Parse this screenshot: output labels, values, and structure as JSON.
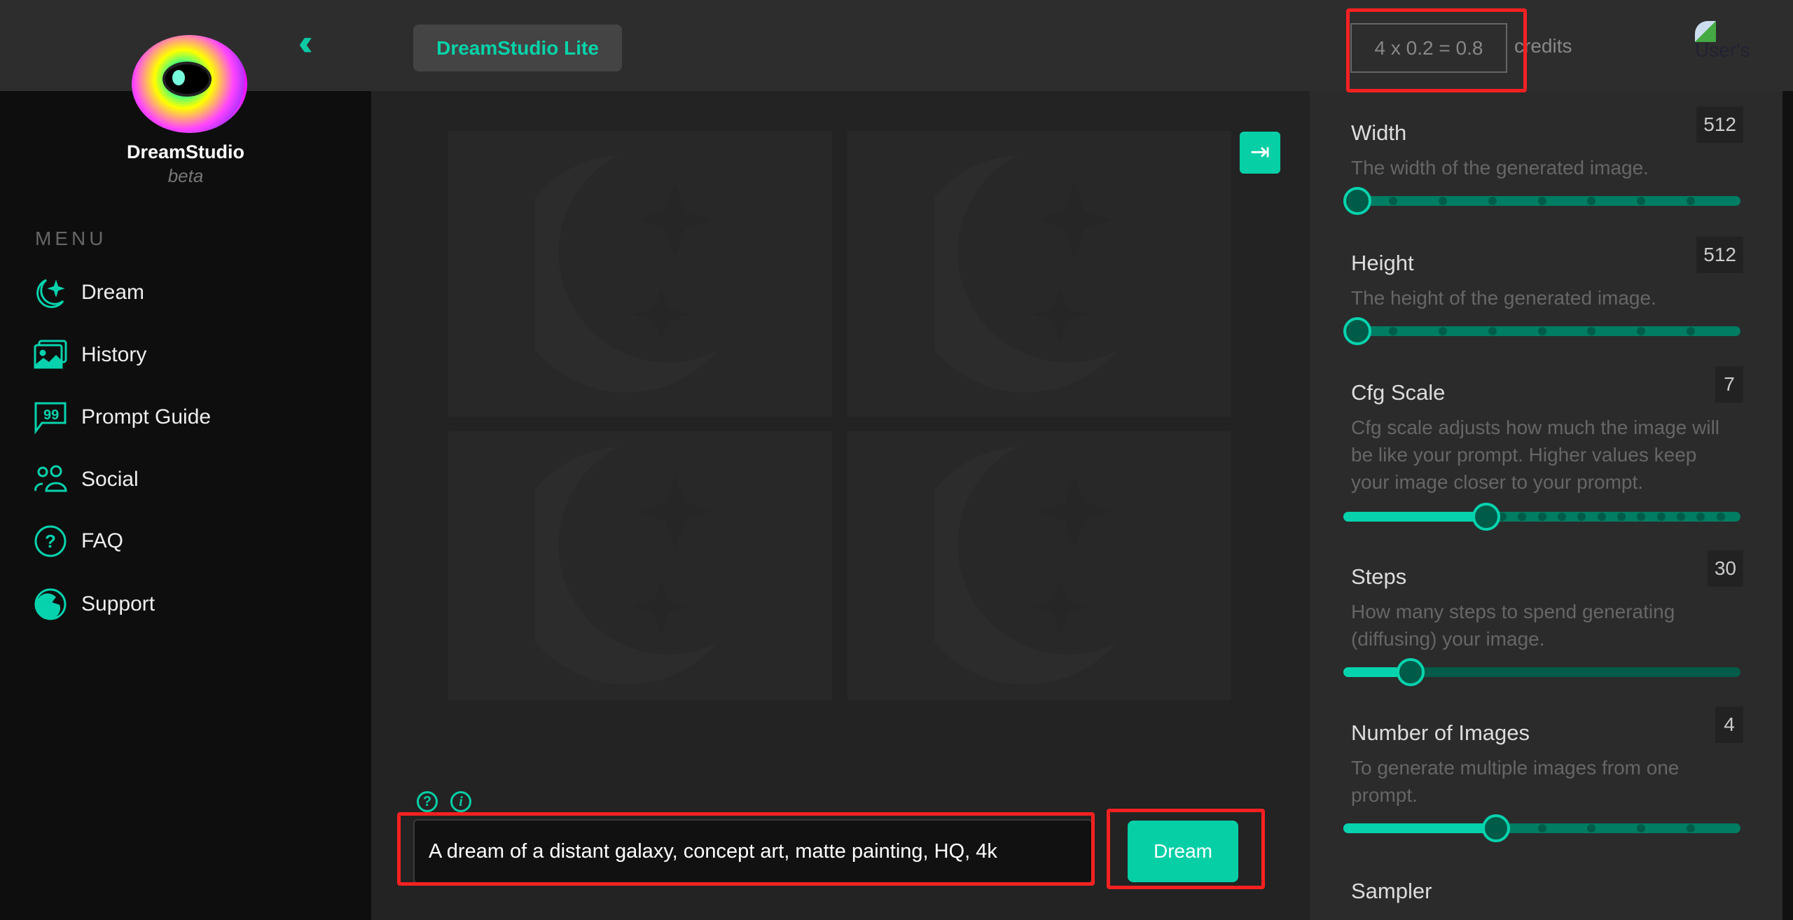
{
  "header": {
    "brand": "DreamStudio",
    "brand_sub": "beta",
    "app_button": "DreamStudio Lite",
    "credits_formula": "4 x 0.2 = 0.8",
    "credits_label": "credits",
    "avatar_alt": "User's"
  },
  "menu": {
    "title": "MENU",
    "items": [
      {
        "label": "Dream",
        "icon": "moon-stars-icon"
      },
      {
        "label": "History",
        "icon": "images-icon"
      },
      {
        "label": "Prompt Guide",
        "icon": "quote-bubble-icon"
      },
      {
        "label": "Social",
        "icon": "users-icon"
      },
      {
        "label": "FAQ",
        "icon": "question-circle-icon"
      },
      {
        "label": "Support",
        "icon": "support-icon"
      }
    ]
  },
  "prompt": {
    "value": "A dream of a distant galaxy, concept art, matte painting, HQ, 4k",
    "button": "Dream",
    "help_icon": "?",
    "info_icon": "i"
  },
  "settings": [
    {
      "label": "Width",
      "value": "512",
      "desc": "The width of the generated image.",
      "fraction": 0,
      "divisions": 8
    },
    {
      "label": "Height",
      "value": "512",
      "desc": "The height of the generated image.",
      "fraction": 0,
      "divisions": 8
    },
    {
      "label": "Cfg Scale",
      "value": "7",
      "desc": "Cfg scale adjusts how much the image will be like your prompt. Higher values keep your image closer to your prompt.",
      "fraction": 0.35,
      "divisions": 20
    },
    {
      "label": "Steps",
      "value": "30",
      "desc": "How many steps to spend generating (diffusing) your image.",
      "fraction": 0.145,
      "divisions": 0
    },
    {
      "label": "Number of Images",
      "value": "4",
      "desc": "To generate multiple images from one prompt.",
      "fraction": 0.375,
      "divisions": 8
    },
    {
      "label": "Sampler"
    }
  ],
  "colors": {
    "accent": "#06cfa6",
    "highlight": "#f52121"
  }
}
